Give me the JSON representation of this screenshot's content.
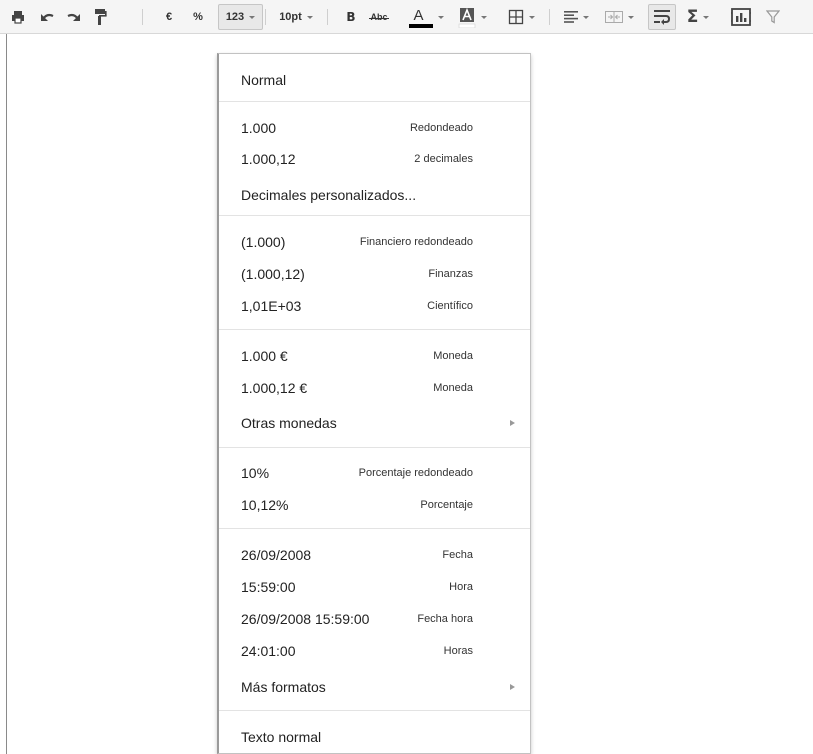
{
  "toolbar": {
    "euro_label": "€",
    "percent_label": "%",
    "number_format_label": "123",
    "font_size_label": "10pt",
    "bold_label": "B",
    "strike_label": "Abc",
    "text_color_label": "A",
    "text_color_swatch": "#000000"
  },
  "menu": {
    "normal": "Normal",
    "rounded_label": "1.000",
    "rounded_hint": "Redondeado",
    "two_decimals_label": "1.000,12",
    "two_decimals_hint": "2 decimales",
    "custom_decimals": "Decimales personalizados...",
    "financial_rounded_label": "(1.000)",
    "financial_rounded_hint": "Financiero redondeado",
    "financial_label": "(1.000,12)",
    "financial_hint": "Finanzas",
    "scientific_label": "1,01E+03",
    "scientific_hint": "Científico",
    "currency_rounded_label": "1.000 €",
    "currency_rounded_hint": "Moneda",
    "currency_label": "1.000,12 €",
    "currency_hint": "Moneda",
    "other_currencies": "Otras monedas",
    "percent_rounded_label": "10%",
    "percent_rounded_hint": "Porcentaje redondeado",
    "percent_label": "10,12%",
    "percent_hint": "Porcentaje",
    "date_label": "26/09/2008",
    "date_hint": "Fecha",
    "time_label": "15:59:00",
    "time_hint": "Hora",
    "datetime_label": "26/09/2008 15:59:00",
    "datetime_hint": "Fecha hora",
    "duration_label": "24:01:00",
    "duration_hint": "Horas",
    "more_formats": "Más formatos",
    "plain_text": "Texto normal"
  }
}
